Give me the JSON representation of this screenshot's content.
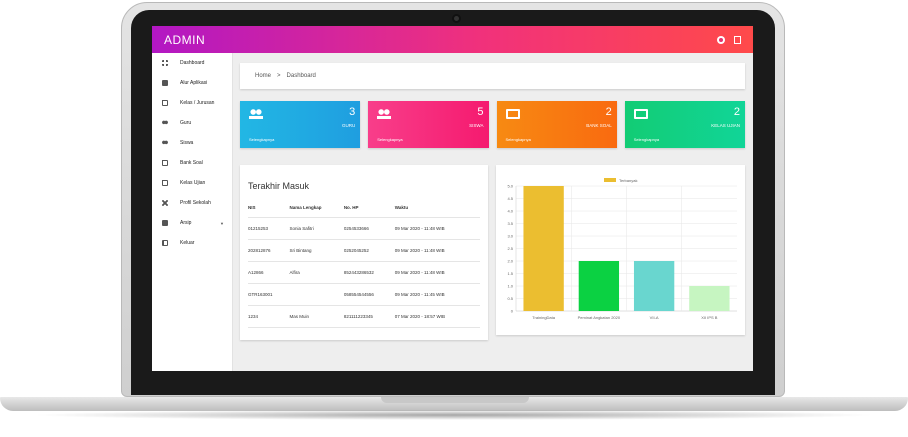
{
  "app": {
    "brand": "ADMIN"
  },
  "sidebar": {
    "items": [
      {
        "label": "Dashboard"
      },
      {
        "label": "Alur Aplikasi"
      },
      {
        "label": "Kelas / Jurusan"
      },
      {
        "label": "Guru"
      },
      {
        "label": "Siswa"
      },
      {
        "label": "Bank Soal"
      },
      {
        "label": "Kelas Ujian"
      },
      {
        "label": "Profil Sekolah"
      },
      {
        "label": "Arsip"
      },
      {
        "label": "Keluar"
      }
    ]
  },
  "breadcrumb": {
    "home": "Home",
    "separator": ">",
    "current": "Dashboard"
  },
  "cards": [
    {
      "value": "3",
      "label": "GURU",
      "more": "Selengkapnya",
      "icon": "people-icon",
      "color": "#1fa6e2"
    },
    {
      "value": "5",
      "label": "SISWA",
      "more": "Selengkapnya",
      "icon": "people-icon",
      "color": "#f5267b"
    },
    {
      "value": "2",
      "label": "BANK SOAL",
      "more": "Selengkapnya",
      "icon": "folder-icon",
      "color": "#f8790f"
    },
    {
      "value": "2",
      "label": "KELAS UJIAN",
      "more": "Selengkapnya",
      "icon": "folder-icon",
      "color": "#11d086"
    }
  ],
  "recent": {
    "title": "Terakhir Masuk",
    "headers": [
      "NIS",
      "Nama Lengkap",
      "No. HP",
      "Waktu"
    ],
    "rows": [
      [
        "01215253",
        "Sonia Safitri",
        "0254533666",
        "09 Mar 2020 - 11:48 WIB"
      ],
      [
        "202812876",
        "Sri Bintang",
        "0252045252",
        "09 Mar 2020 - 11:48 WIB"
      ],
      [
        "A12866",
        "Alfira",
        "852443286532",
        "09 Mar 2020 - 11:48 WIB"
      ],
      [
        "GTR163001",
        "",
        "058554544556",
        "09 Mar 2020 - 11:45 WIB"
      ],
      [
        "1234",
        "Mas Muin",
        "821111223345",
        "07 Mar 2020 - 18:57 WIB"
      ]
    ]
  },
  "chart_data": {
    "type": "bar",
    "categories": [
      "TrainingData",
      "Peminat Angkatan 2020",
      "VII-A",
      "XII IPS B"
    ],
    "series": [
      {
        "name": "Terbanyak",
        "values": [
          5,
          2,
          2,
          1
        ]
      }
    ],
    "bar_colors": [
      "#ebbe30",
      "#0bd142",
      "#69d6cf",
      "#c6f5c1"
    ],
    "legend_color": "#ebbe30",
    "ylim": [
      0,
      5
    ],
    "yticks": [
      "0",
      "0.5",
      "1.0",
      "1.5",
      "2.0",
      "2.5",
      "3.0",
      "3.5",
      "4.0",
      "4.5",
      "5.0"
    ],
    "legend_position": "top",
    "grid": true
  }
}
